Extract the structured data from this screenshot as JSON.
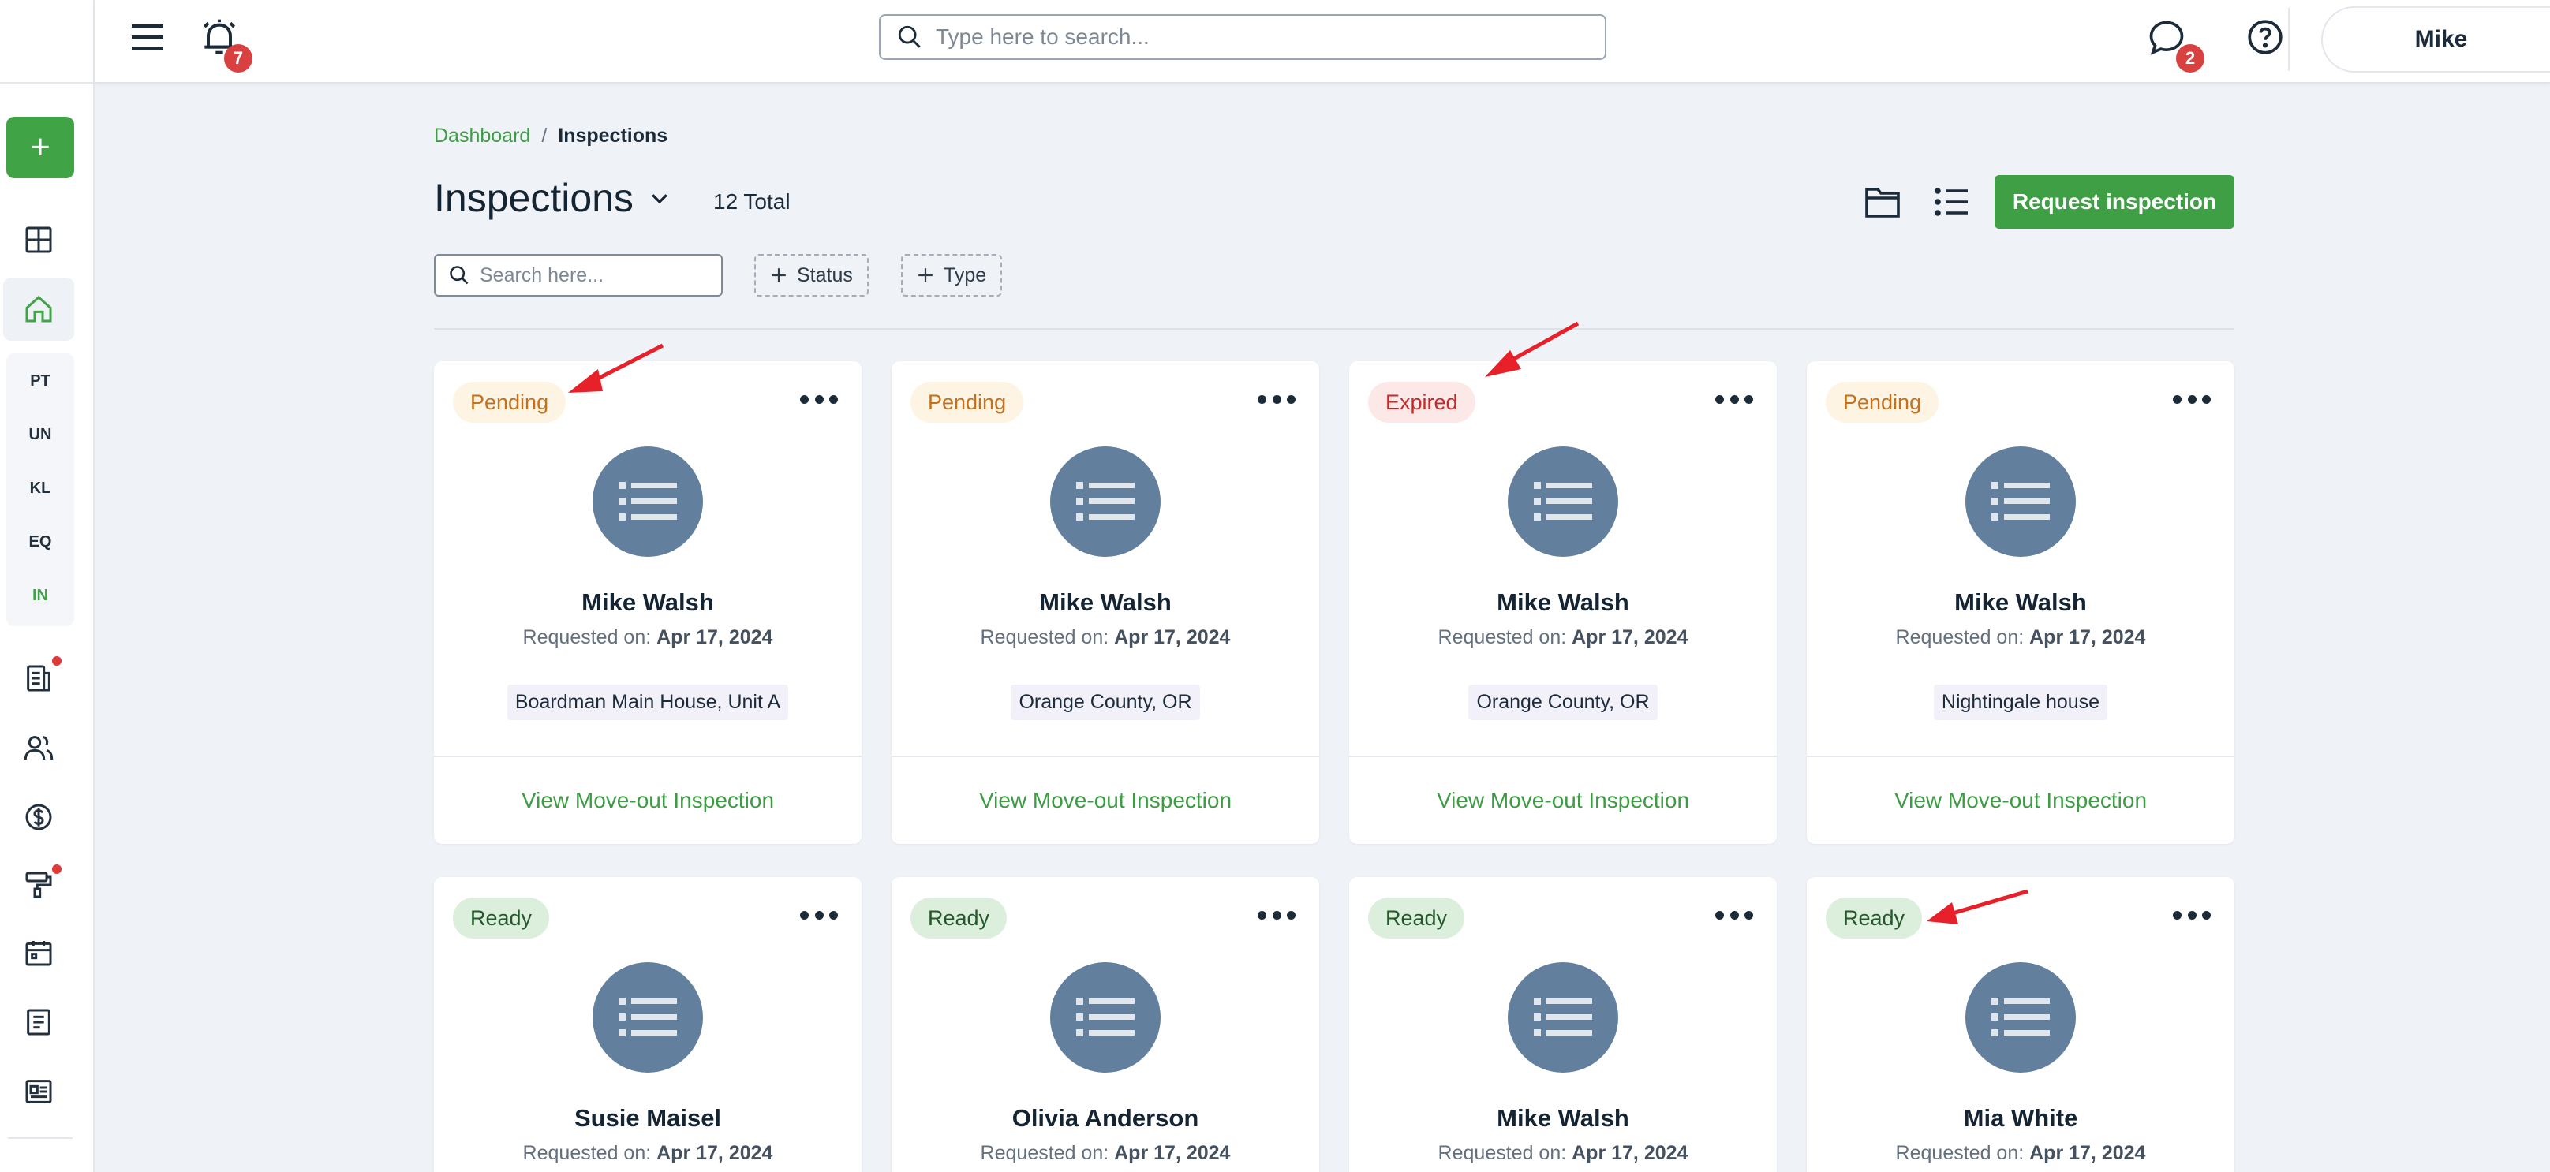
{
  "topbar": {
    "notification_count": "7",
    "search_placeholder": "Type here to search...",
    "message_count": "2",
    "user_name": "Mike"
  },
  "sidebar": {
    "add_label": "+",
    "abbreviations": [
      {
        "label": "PT",
        "active": false
      },
      {
        "label": "UN",
        "active": false
      },
      {
        "label": "KL",
        "active": false
      },
      {
        "label": "EQ",
        "active": false
      },
      {
        "label": "IN",
        "active": true
      }
    ]
  },
  "breadcrumb": {
    "parent": "Dashboard",
    "separator": "/",
    "current": "Inspections"
  },
  "page": {
    "title": "Inspections",
    "total": "12 Total",
    "request_button": "Request inspection",
    "search_placeholder": "Search here...",
    "filters": [
      "Status",
      "Type"
    ]
  },
  "cards": [
    {
      "status": "Pending",
      "status_type": "pending",
      "name": "Mike Walsh",
      "requested_prefix": "Requested on:",
      "date": "Apr 17, 2024",
      "location": "Boardman Main House, Unit A",
      "link": "View Move-out Inspection"
    },
    {
      "status": "Pending",
      "status_type": "pending",
      "name": "Mike Walsh",
      "requested_prefix": "Requested on:",
      "date": "Apr 17, 2024",
      "location": "Orange County, OR",
      "link": "View Move-out Inspection"
    },
    {
      "status": "Expired",
      "status_type": "expired",
      "name": "Mike Walsh",
      "requested_prefix": "Requested on:",
      "date": "Apr 17, 2024",
      "location": "Orange County, OR",
      "link": "View Move-out Inspection"
    },
    {
      "status": "Pending",
      "status_type": "pending",
      "name": "Mike Walsh",
      "requested_prefix": "Requested on:",
      "date": "Apr 17, 2024",
      "location": "Nightingale house",
      "link": "View Move-out Inspection"
    },
    {
      "status": "Ready",
      "status_type": "ready",
      "name": "Susie Maisel",
      "requested_prefix": "Requested on:",
      "date": "Apr 17, 2024"
    },
    {
      "status": "Ready",
      "status_type": "ready",
      "name": "Olivia Anderson",
      "requested_prefix": "Requested on:",
      "date": "Apr 17, 2024"
    },
    {
      "status": "Ready",
      "status_type": "ready",
      "name": "Mike Walsh",
      "requested_prefix": "Requested on:",
      "date": "Apr 17, 2024"
    },
    {
      "status": "Ready",
      "status_type": "ready",
      "name": "Mia White",
      "requested_prefix": "Requested on:",
      "date": "Apr 17, 2024"
    }
  ],
  "colors": {
    "brand_green": "#40a446",
    "pending": "#c5701b",
    "expired": "#c62828",
    "ready": "#24572a",
    "annotation_arrow": "#e8202a"
  }
}
